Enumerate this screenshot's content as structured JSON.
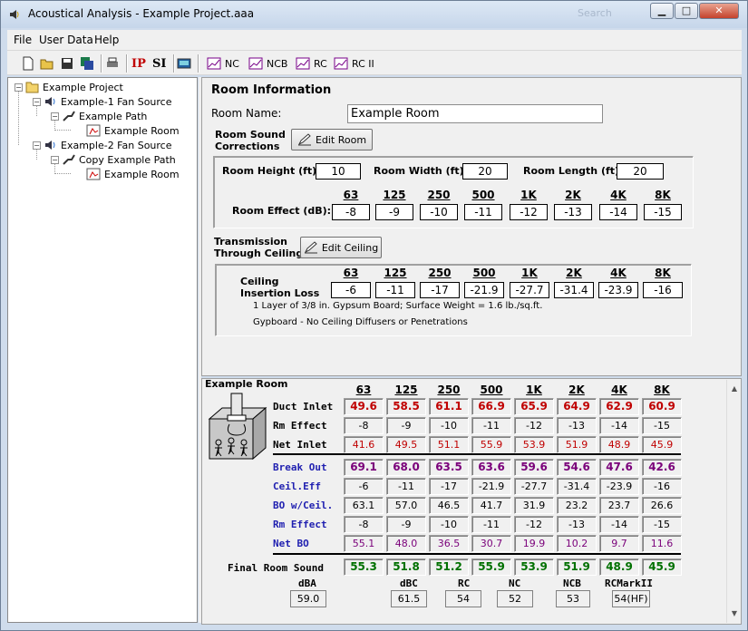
{
  "window": {
    "title": "Acoustical Analysis - Example Project.aaa",
    "ghost_text": "Search"
  },
  "window_buttons": {
    "minimize": "▁",
    "maximize": "□",
    "close": "✕"
  },
  "menu": [
    "File",
    "User Data",
    "Help"
  ],
  "toolbar": {
    "ip": "IP",
    "si": "SI",
    "nc": "NC",
    "ncb": "NCB",
    "rc": "RC",
    "rc2": "RC II"
  },
  "tree": {
    "root": "Example Project",
    "items": [
      "Example-1 Fan Source",
      "Example Path",
      "Example Room",
      "Example-2 Fan Source",
      "Copy Example Path",
      "Example Room"
    ]
  },
  "room_info": {
    "heading": "Room Information",
    "name_label": "Room Name:",
    "name_value": "Example Room",
    "corrections_label": "Room Sound Corrections",
    "edit_room": "Edit Room",
    "height_label": "Room Height (ft):",
    "height": "10",
    "width_label": "Room Width (ft):",
    "width": "20",
    "length_label": "Room Length (ft):",
    "length": "20",
    "effect_label": "Room Effect (dB):",
    "bands": [
      "63",
      "125",
      "250",
      "500",
      "1K",
      "2K",
      "4K",
      "8K"
    ],
    "effect": [
      "-8",
      "-9",
      "-10",
      "-11",
      "-12",
      "-13",
      "-14",
      "-15"
    ]
  },
  "ceiling": {
    "label": "Transmission Through Ceiling",
    "edit": "Edit Ceiling",
    "loss_label": "Ceiling Insertion Loss",
    "loss": [
      "-6",
      "-11",
      "-17",
      "-21.9",
      "-27.7",
      "-31.4",
      "-23.9",
      "-16"
    ],
    "desc1": "1 Layer of 3/8 in. Gypsum Board; Surface Weight = 1.6 lb./sq.ft.",
    "desc2": "Gypboard - No Ceiling Diffusers or Penetrations"
  },
  "results": {
    "title": "Example Room",
    "bands": [
      "63",
      "125",
      "250",
      "500",
      "1K",
      "2K",
      "4K",
      "8K"
    ],
    "rows": [
      {
        "label": "Duct Inlet",
        "color": "#c00000",
        "bold": true,
        "values": [
          "49.6",
          "58.5",
          "61.1",
          "66.9",
          "65.9",
          "64.9",
          "62.9",
          "60.9"
        ]
      },
      {
        "label": "Rm Effect",
        "color": "#000000",
        "bold": false,
        "values": [
          "-8",
          "-9",
          "-10",
          "-11",
          "-12",
          "-13",
          "-14",
          "-15"
        ]
      },
      {
        "label": "Net Inlet",
        "color": "#c00000",
        "bold": false,
        "values": [
          "41.6",
          "49.5",
          "51.1",
          "55.9",
          "53.9",
          "51.9",
          "48.9",
          "45.9"
        ]
      },
      {
        "label": "Break Out",
        "color": "#7a007a",
        "bold": true,
        "values": [
          "69.1",
          "68.0",
          "63.5",
          "63.6",
          "59.6",
          "54.6",
          "47.6",
          "42.6"
        ]
      },
      {
        "label": "Ceil.Eff",
        "color": "#000000",
        "bold": false,
        "values": [
          "-6",
          "-11",
          "-17",
          "-21.9",
          "-27.7",
          "-31.4",
          "-23.9",
          "-16"
        ]
      },
      {
        "label": "BO w/Ceil.",
        "color": "#000000",
        "bold": false,
        "values": [
          "63.1",
          "57.0",
          "46.5",
          "41.7",
          "31.9",
          "23.2",
          "23.7",
          "26.6"
        ]
      },
      {
        "label": "Rm Effect",
        "color": "#000000",
        "bold": false,
        "values": [
          "-8",
          "-9",
          "-10",
          "-11",
          "-12",
          "-13",
          "-14",
          "-15"
        ]
      },
      {
        "label": "Net BO",
        "color": "#7a007a",
        "bold": false,
        "values": [
          "55.1",
          "48.0",
          "36.5",
          "30.7",
          "19.9",
          "10.2",
          "9.7",
          "11.6"
        ]
      }
    ],
    "final": {
      "label": "Final Room Sound",
      "color": "#007000",
      "values": [
        "55.3",
        "51.8",
        "51.2",
        "55.9",
        "53.9",
        "51.9",
        "48.9",
        "45.9"
      ]
    },
    "summary": [
      {
        "label": "dBA",
        "value": "59.0"
      },
      {
        "label": "dBC",
        "value": "61.5"
      },
      {
        "label": "RC",
        "value": "54"
      },
      {
        "label": "NC",
        "value": "52"
      },
      {
        "label": "NCB",
        "value": "53"
      },
      {
        "label": "RCMarkII",
        "value": "54(HF)"
      }
    ]
  },
  "colors": {
    "duct": "#c00000",
    "breakout": "#7a007a",
    "final": "#007000",
    "label_blue": "#1f1fb0"
  }
}
